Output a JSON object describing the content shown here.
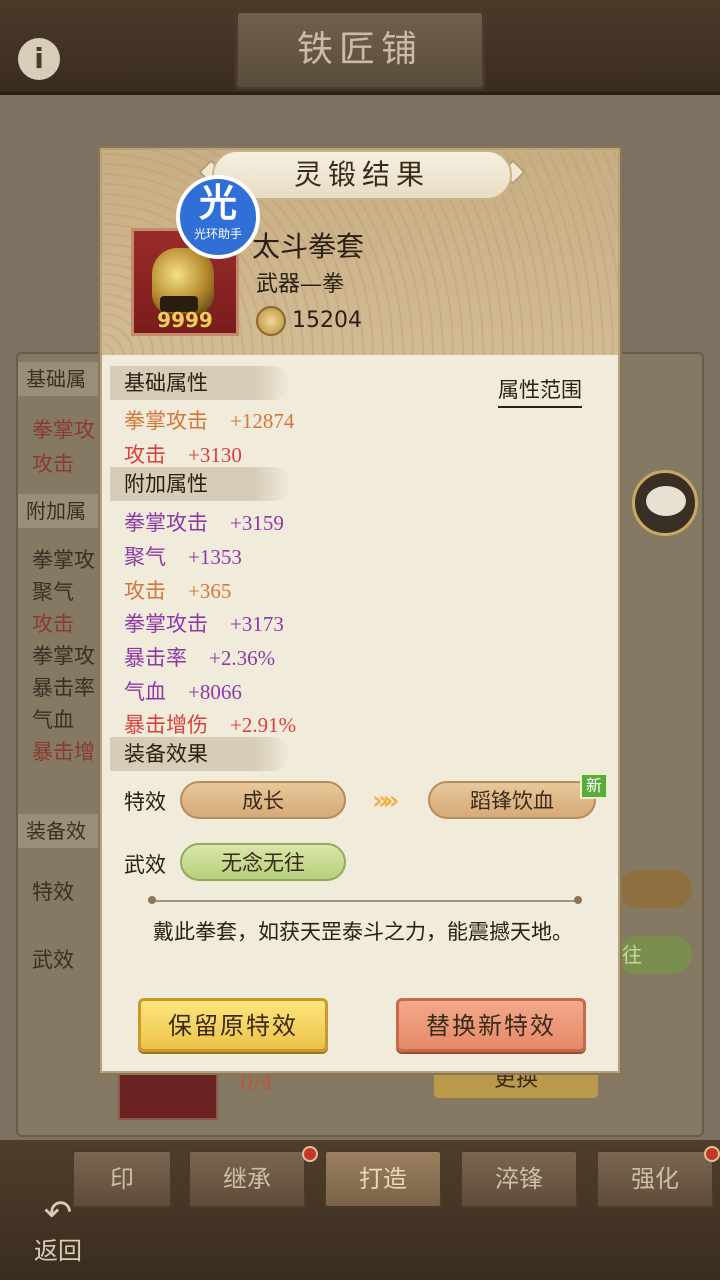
{
  "background": {
    "screen_title": "铁匠铺",
    "info_icon": "i",
    "panel": {
      "base_header": "基础属",
      "base_stats": [
        "拳掌攻",
        "攻击"
      ],
      "extra_header": "附加属",
      "extra_stats": [
        "拳掌攻",
        "聚气",
        "攻击",
        "拳掌攻",
        "暴击率",
        "气血",
        "暴击增"
      ],
      "equip_header": "装备效",
      "special_label": "特效",
      "martial_label": "武效",
      "count": "0/4",
      "right_btn": "更换",
      "right_green": "往"
    },
    "nav": {
      "tabs": [
        "印",
        "继承",
        "打造",
        "淬锋",
        "强化"
      ],
      "back": "返回"
    }
  },
  "modal": {
    "title": "灵锻结果",
    "item": {
      "name": "太斗拳套",
      "type": "武器—拳",
      "quantity": "9999",
      "power": "15204"
    },
    "watermark": {
      "char": "光",
      "label": "光环助手"
    },
    "attr_range_link": "属性范围",
    "base_section": "基础属性",
    "base_stats": [
      {
        "name": "拳掌攻击",
        "value": "+12874",
        "color": "orange"
      },
      {
        "name": "攻击",
        "value": "+3130",
        "color": "red"
      }
    ],
    "extra_section": "附加属性",
    "extra_stats": [
      {
        "name": "拳掌攻击",
        "value": "+3159",
        "color": "purple"
      },
      {
        "name": "聚气",
        "value": "+1353",
        "color": "purple"
      },
      {
        "name": "攻击",
        "value": "+365",
        "color": "orange"
      },
      {
        "name": "拳掌攻击",
        "value": "+3173",
        "color": "purple"
      },
      {
        "name": "暴击率",
        "value": "+2.36%",
        "color": "purple"
      },
      {
        "name": "气血",
        "value": "+8066",
        "color": "purple"
      },
      {
        "name": "暴击增伤",
        "value": "+2.91%",
        "color": "red"
      }
    ],
    "equip_section": "装备效果",
    "special_label": "特效",
    "special_old": "成长",
    "special_new": "蹈锋饮血",
    "new_badge": "新",
    "martial_label": "武效",
    "martial_value": "无念无往",
    "description": "戴此拳套，如获天罡泰斗之力，能震撼天地。",
    "keep_button": "保留原特效",
    "replace_button": "替换新特效"
  }
}
